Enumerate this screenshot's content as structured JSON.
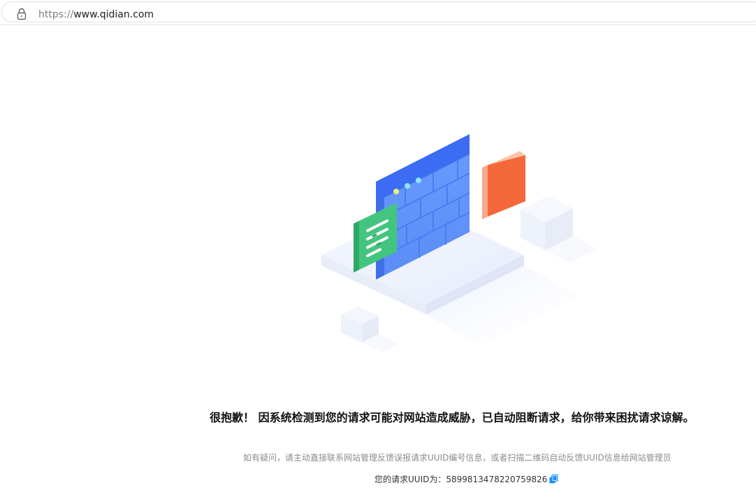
{
  "browser": {
    "url_scheme": "https://",
    "url_host": "www.qidian.com",
    "lock_icon": "lock-icon"
  },
  "message": {
    "headline": "很抱歉！ 因系统检测到您的请求可能对网站造成威胁，已自动阻断请求，给你带来困扰请求谅解。",
    "hint": "如有疑问，请主动直接联系网站管理反馈误报请求UUID编号信息，或者扫描二维码自动反馈UUID信息给网站管理员",
    "uuid_label": "您的请求UUID为：",
    "uuid_value": "5899813478220759826",
    "copy_icon": "copy-icon"
  },
  "colors": {
    "wall_blue": "#5b8ff9",
    "wall_top": "#3d6ef5",
    "green_card": "#3fc27a",
    "orange_block": "#f4683b",
    "copy_icon": "#1890ff"
  }
}
